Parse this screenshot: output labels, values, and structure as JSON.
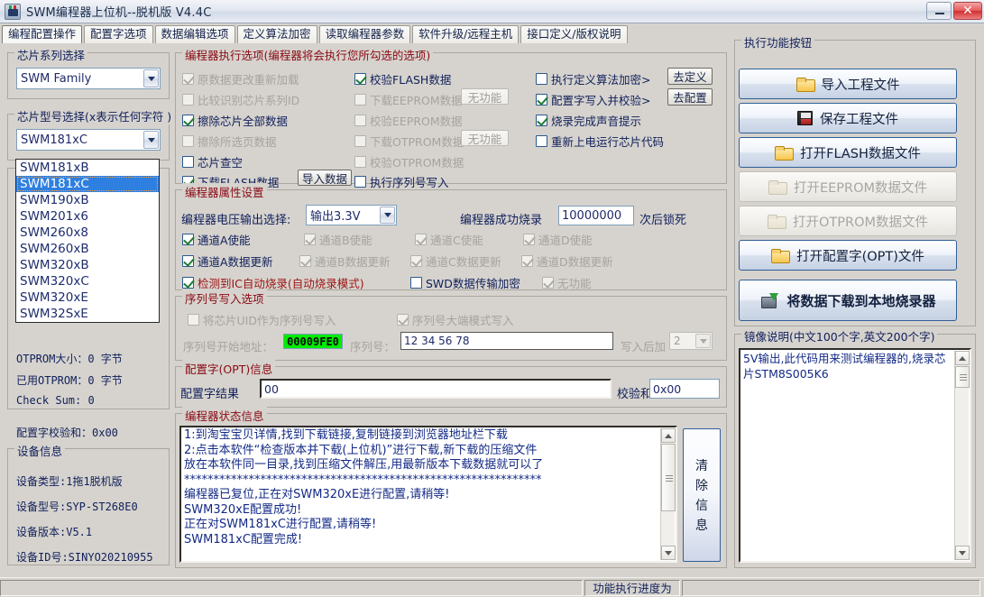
{
  "window": {
    "title": "SWM编程器上位机--脱机版 V4.4C",
    "minimize_label": "",
    "close_label": "✕"
  },
  "tabs": [
    {
      "label": "编程配置操作",
      "active": true
    },
    {
      "label": "配置字选项",
      "active": false
    },
    {
      "label": "数据编辑选项",
      "active": false
    },
    {
      "label": "定义算法加密",
      "active": false
    },
    {
      "label": "读取编程器参数",
      "active": false
    },
    {
      "label": "软件升级/远程主机",
      "active": false
    },
    {
      "label": "接口定义/版权说明",
      "active": false
    }
  ],
  "chip_series": {
    "group_label": "芯片系列选择",
    "value": "SWM Family"
  },
  "chip_model": {
    "group_label": "芯片型号选择(x表示任何字符 )",
    "value": "SWM181xC",
    "options": [
      "SWM181xB",
      "SWM181xC",
      "SWM190xB",
      "SWM201x6",
      "SWM260x8",
      "SWM260xB",
      "SWM320xB",
      "SWM320xC",
      "SWM320xE",
      "SWM32SxE"
    ],
    "selected_index": 1,
    "dropdown_open": true
  },
  "chip_info": {
    "check_sum_1": "Check Sum: 0",
    "otprom_size": "OTPROM大小：0 字节",
    "otprom_used": "已用OTPROM：0 字节",
    "check_sum_2": "Check Sum: 0",
    "opt_checksum": "配置字校验和：0x00"
  },
  "device_info": {
    "group_label": "设备信息",
    "rows": [
      "设备类型:1拖1脱机版",
      "设备型号:SYP-ST268E0",
      "设备版本:V5.1",
      "设备ID号:SINYO20210955"
    ]
  },
  "exec_options": {
    "group_label": "编程器执行选项(编程器将会执行您所勾选的选项)",
    "col1": [
      {
        "label": "原数据更改重新加载",
        "checked": true,
        "disabled": true
      },
      {
        "label": "比较识别芯片系列ID",
        "checked": false,
        "disabled": true
      },
      {
        "label": "擦除芯片全部数据",
        "checked": true,
        "disabled": false
      },
      {
        "label": "擦除所选页数据",
        "checked": false,
        "disabled": true
      },
      {
        "label": "芯片查空",
        "checked": false,
        "disabled": false
      },
      {
        "label": "下载FLASH数据",
        "checked": true,
        "disabled": false
      }
    ],
    "col1_button": "导入数据",
    "col2": [
      {
        "label": "校验FLASH数据",
        "checked": true,
        "disabled": false,
        "button": ""
      },
      {
        "label": "下载EEPROM数据",
        "checked": false,
        "disabled": true,
        "button": "无功能"
      },
      {
        "label": "校验EEPROM数据",
        "checked": false,
        "disabled": true,
        "button": ""
      },
      {
        "label": "下载OTPROM数据",
        "checked": false,
        "disabled": true,
        "button": "无功能"
      },
      {
        "label": "校验OTPROM数据",
        "checked": false,
        "disabled": true,
        "button": ""
      },
      {
        "label": "执行序列号写入",
        "checked": false,
        "disabled": false,
        "button": ""
      }
    ],
    "col3": [
      {
        "label": "执行定义算法加密>",
        "checked": false,
        "disabled": false,
        "button": "去定义"
      },
      {
        "label": "配置字写入并校验>",
        "checked": true,
        "disabled": false,
        "button": "去配置"
      },
      {
        "label": "烧录完成声音提示",
        "checked": true,
        "disabled": false,
        "button": ""
      },
      {
        "label": "重新上电运行芯片代码",
        "checked": false,
        "disabled": false,
        "button": ""
      }
    ]
  },
  "props": {
    "group_label": "编程器属性设置",
    "voltage_label": "编程器电压输出选择:",
    "voltage_value": "输出3.3V",
    "lock_prefix": "编程器成功烧录",
    "lock_count": "10000000",
    "lock_suffix": "次后锁死",
    "channels_enable": [
      {
        "label": "通道A使能",
        "checked": true,
        "disabled": false
      },
      {
        "label": "通道B使能",
        "checked": true,
        "disabled": true
      },
      {
        "label": "通道C使能",
        "checked": true,
        "disabled": true
      },
      {
        "label": "通道D使能",
        "checked": true,
        "disabled": true
      }
    ],
    "channels_update": [
      {
        "label": "通道A数据更新",
        "checked": true,
        "disabled": false
      },
      {
        "label": "通道B数据更新",
        "checked": true,
        "disabled": true
      },
      {
        "label": "通道C数据更新",
        "checked": true,
        "disabled": true
      },
      {
        "label": "通道D数据更新",
        "checked": true,
        "disabled": true
      }
    ],
    "auto_burn": {
      "label": "检测到IC自动烧录(自动烧录模式)",
      "checked": true,
      "disabled": false
    },
    "swd_encrypt": {
      "label": "SWD数据传输加密",
      "checked": false,
      "disabled": false
    },
    "no_function": {
      "label": "无功能",
      "checked": true,
      "disabled": true
    }
  },
  "serial": {
    "group_label": "序列号写入选项",
    "uid_as_serial": {
      "label": "将芯片UID作为序列号写入",
      "checked": false,
      "disabled": true
    },
    "big_endian": {
      "label": "序列号大端模式写入",
      "checked": true,
      "disabled": true
    },
    "start_addr_label": "序列号开始地址：",
    "start_addr_value": "00009FE0",
    "serial_label": "序列号：",
    "serial_value": "12 34 56 78",
    "increment_label": "写入后加",
    "increment_value": "2"
  },
  "opt_word": {
    "group_label": "配置字(OPT)信息",
    "result_label": "配置字结果",
    "result_value": "00",
    "checksum_label": "校验和:",
    "checksum_value": "0x00"
  },
  "status_log": {
    "group_label": "编程器状态信息",
    "text": "1:到淘宝宝贝详情,找到下载链接,复制链接到浏览器地址栏下载\n2:点击本软件“检查版本并下载(上位机)”进行下载,新下载的压缩文件\n放在本软件同一目录,找到压缩文件解压,用最新版本下载数据就可以了\n*************************************************************\n编程器已复位,正在对SWM320xE进行配置,请稍等!\nSWM320xE配置成功!\n正在对SWM181xC进行配置,请稍等!\nSWM181xC配置完成!"
  },
  "clear_button": {
    "label": "清除信息",
    "chars": [
      "清",
      "除",
      "信",
      "息"
    ]
  },
  "action_buttons": {
    "group_label": "执行功能按钮",
    "items": [
      {
        "label": "导入工程文件",
        "icon": "folder-icon",
        "disabled": false,
        "strong": false
      },
      {
        "label": "保存工程文件",
        "icon": "save-icon",
        "disabled": false,
        "strong": false
      },
      {
        "label": "打开FLASH数据文件",
        "icon": "folder-icon",
        "disabled": false,
        "strong": false
      },
      {
        "label": "打开EEPROM数据文件",
        "icon": "folder-icon",
        "disabled": true,
        "strong": false
      },
      {
        "label": "打开OTPROM数据文件",
        "icon": "folder-icon",
        "disabled": true,
        "strong": false
      },
      {
        "label": "打开配置字(OPT)文件",
        "icon": "folder-icon",
        "disabled": false,
        "strong": false
      },
      {
        "label": "将数据下载到本地烧录器",
        "icon": "chip-download-icon",
        "disabled": false,
        "strong": true
      }
    ]
  },
  "image_note": {
    "group_label": "镜像说明(中文100个字,英文200个字)",
    "text": "5V输出,此代码用来测试编程器的,烧录芯片STM8S005K6"
  },
  "statusbar": {
    "progress_label": "功能执行进度为"
  },
  "colors": {
    "group_label_red": "#8b0a14",
    "text_blue": "#101f5a",
    "accent_blue": "#2f5f96",
    "serial_addr_bg": "#00ec00",
    "selection_blue": "#2f7fe0"
  }
}
